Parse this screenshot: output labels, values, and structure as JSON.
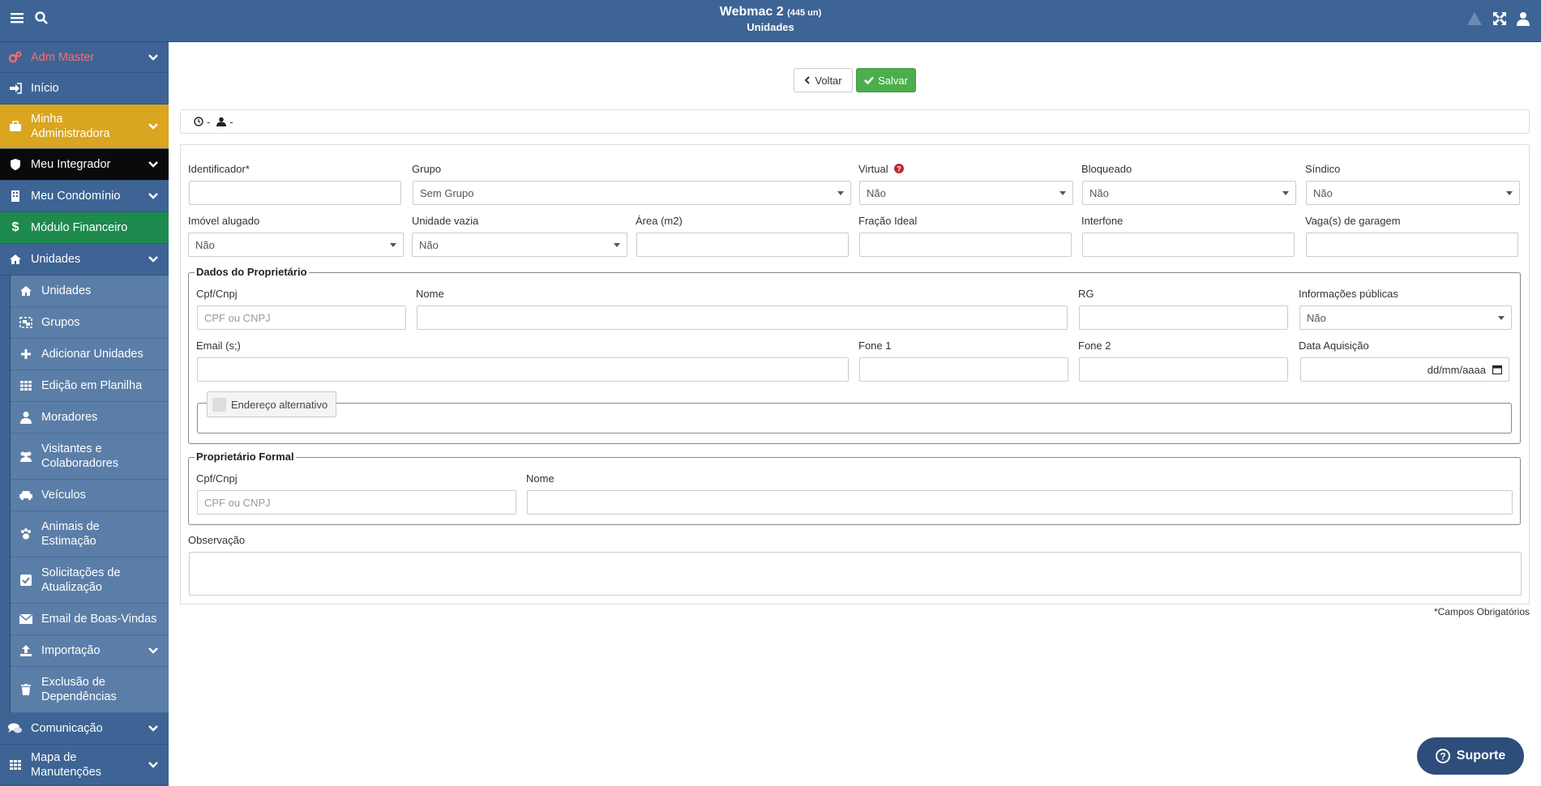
{
  "header": {
    "app_title": "Webmac 2",
    "app_count": "(445 un)",
    "page_title": "Unidades",
    "icons": [
      "menu-icon",
      "search-icon",
      "warning-icon",
      "expand-icon",
      "user-icon"
    ]
  },
  "sidebar": {
    "items": [
      {
        "label": "Adm Master",
        "icon": "cogs-icon",
        "chevron": true,
        "color": "#ff6b6b"
      },
      {
        "label": "Início",
        "icon": "sign-in-icon"
      },
      {
        "label": "Minha Administradora",
        "icon": "briefcase-icon",
        "chevron": true,
        "bg": "#daa51f"
      },
      {
        "label": "Meu Integrador",
        "icon": "shield-icon",
        "chevron": true,
        "bg": "#0a0a0a"
      },
      {
        "label": "Meu Condomínio",
        "icon": "building-icon",
        "chevron": true
      },
      {
        "label": "Módulo Financeiro",
        "icon": "dollar-icon",
        "bg": "#1e8a4e"
      },
      {
        "label": "Unidades",
        "icon": "home-icon",
        "chevron": true
      }
    ],
    "unidades_sub": [
      {
        "label": "Unidades",
        "icon": "home-icon"
      },
      {
        "label": "Grupos",
        "icon": "object-group-icon"
      },
      {
        "label": "Adicionar Unidades",
        "icon": "plus-icon"
      },
      {
        "label": "Edição em Planilha",
        "icon": "table-icon"
      },
      {
        "label": "Moradores",
        "icon": "user-icon"
      },
      {
        "label": "Visitantes e Colaboradores",
        "icon": "users-icon"
      },
      {
        "label": "Veículos",
        "icon": "car-icon"
      },
      {
        "label": "Animais de Estimação",
        "icon": "paw-icon"
      },
      {
        "label": "Solicitações de Atualização",
        "icon": "check-square-icon"
      },
      {
        "label": "Email de Boas-Vindas",
        "icon": "envelope-icon"
      },
      {
        "label": "Importação",
        "icon": "upload-icon",
        "chevron": true
      },
      {
        "label": "Exclusão de Dependências",
        "icon": "trash-icon"
      }
    ],
    "bottom": [
      {
        "label": "Comunicação",
        "icon": "comments-icon",
        "chevron": true
      },
      {
        "label": "Mapa de Manutenções",
        "icon": "table-icon",
        "chevron": true
      }
    ]
  },
  "toolbar": {
    "voltar": "Voltar",
    "salvar": "Salvar"
  },
  "infobar": {
    "clock_text": "-",
    "user_text": "-"
  },
  "form": {
    "identificador": {
      "label": "Identificador",
      "req": "*",
      "value": ""
    },
    "grupo": {
      "label": "Grupo",
      "value": "Sem Grupo"
    },
    "virtual": {
      "label": "Virtual",
      "value": "Não"
    },
    "bloqueado": {
      "label": "Bloqueado",
      "value": "Não"
    },
    "sindico": {
      "label": "Síndico",
      "value": "Não"
    },
    "imovel_alugado": {
      "label": "Imóvel alugado",
      "value": "Não"
    },
    "unidade_vazia": {
      "label": "Unidade vazia",
      "value": "Não"
    },
    "area": {
      "label": "Área (m2)",
      "value": ""
    },
    "fracao": {
      "label": "Fração Ideal",
      "value": ""
    },
    "interfone": {
      "label": "Interfone",
      "value": ""
    },
    "vagas": {
      "label": "Vaga(s) de garagem",
      "value": ""
    }
  },
  "proprietario": {
    "legend": "Dados do Proprietário",
    "cpf": {
      "label": "Cpf/Cnpj",
      "placeholder": "CPF ou CNPJ"
    },
    "nome": {
      "label": "Nome"
    },
    "rg": {
      "label": "RG"
    },
    "info_publicas": {
      "label": "Informações públicas",
      "value": "Não"
    },
    "email": {
      "label": "Email (s;)"
    },
    "fone1": {
      "label": "Fone 1"
    },
    "fone2": {
      "label": "Fone 2"
    },
    "data_aquisicao": {
      "label": "Data Aquisição",
      "placeholder": "dd/mm/aaaa"
    },
    "endereco_alt": "Endereço alternativo"
  },
  "proprietario_formal": {
    "legend": "Proprietário Formal",
    "cpf": {
      "label": "Cpf/Cnpj",
      "placeholder": "CPF ou CNPJ"
    },
    "nome": {
      "label": "Nome"
    }
  },
  "observacao": {
    "label": "Observação"
  },
  "footer_note": "*Campos Obrigatórios",
  "suporte": "Suporte",
  "colors": {
    "primary": "#3d6494",
    "success": "#4cae4c",
    "warning": "#daa51f",
    "financeiro": "#1e8a4e"
  }
}
